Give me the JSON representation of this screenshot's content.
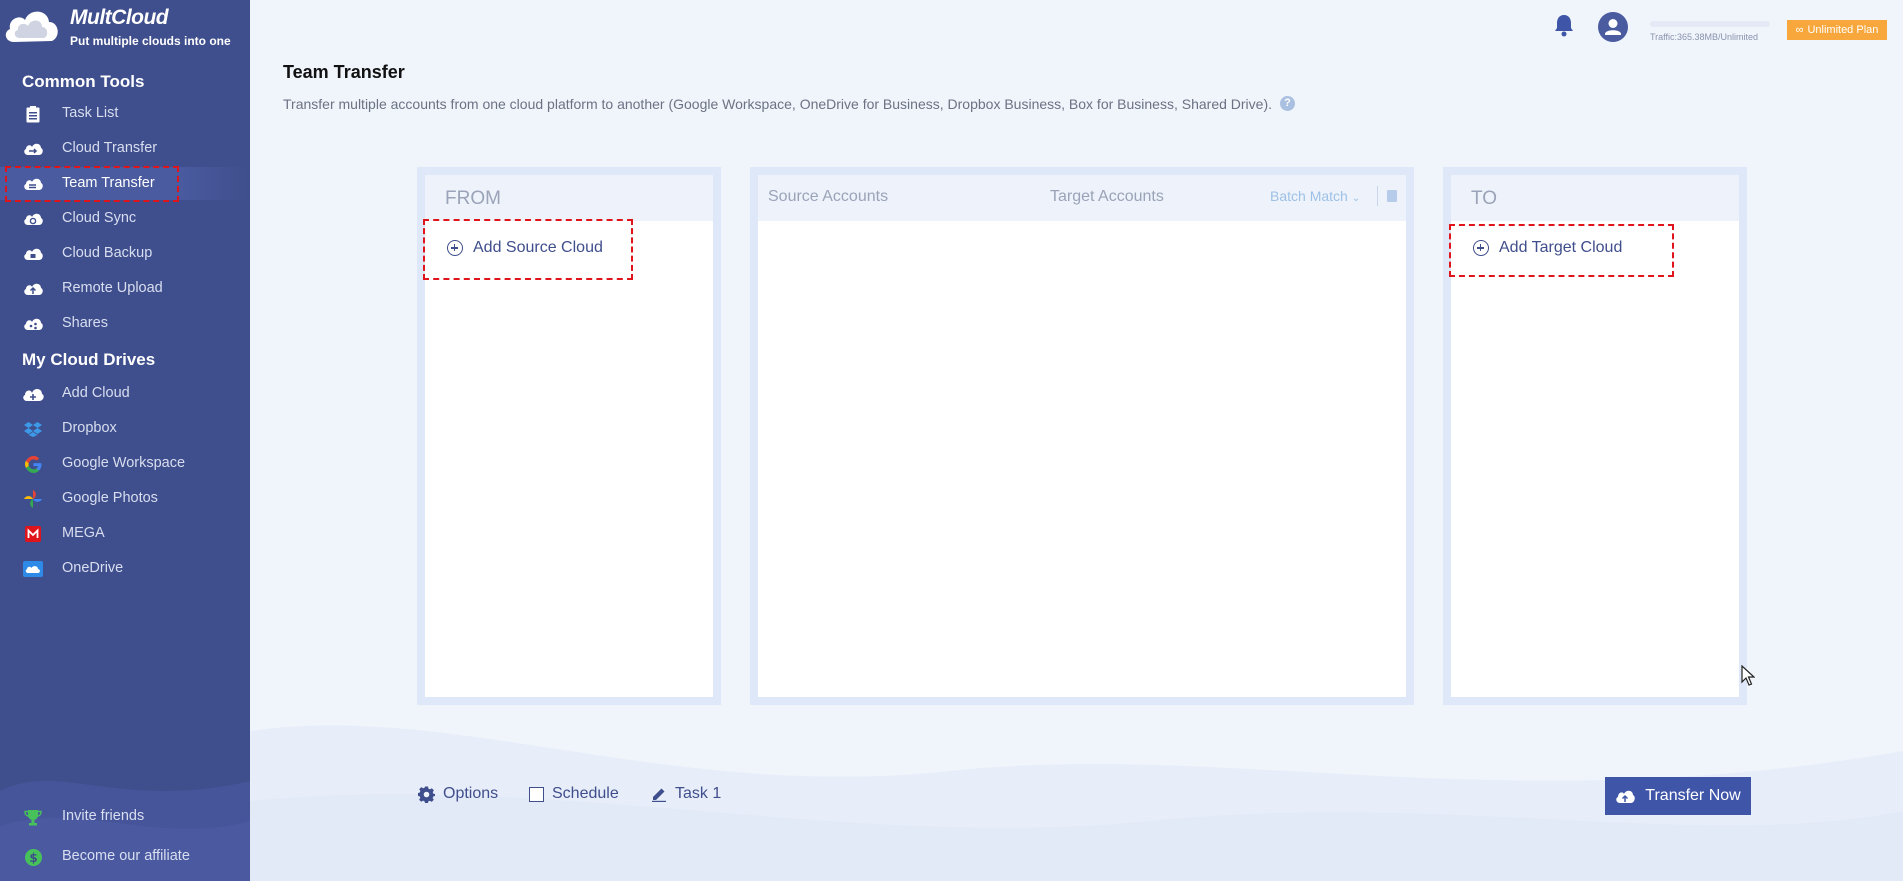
{
  "brand": {
    "name": "MultCloud",
    "tagline": "Put multiple clouds into one"
  },
  "sidebar": {
    "common_tools_title": "Common Tools",
    "common_tools": [
      {
        "label": "Task List",
        "icon": "task-list-icon"
      },
      {
        "label": "Cloud Transfer",
        "icon": "cloud-transfer-icon"
      },
      {
        "label": "Team Transfer",
        "icon": "team-transfer-icon",
        "active": true
      },
      {
        "label": "Cloud Sync",
        "icon": "cloud-sync-icon"
      },
      {
        "label": "Cloud Backup",
        "icon": "cloud-backup-icon"
      },
      {
        "label": "Remote Upload",
        "icon": "remote-upload-icon"
      },
      {
        "label": "Shares",
        "icon": "shares-icon"
      }
    ],
    "drives_title": "My Cloud Drives",
    "drives": [
      {
        "label": "Add Cloud",
        "icon": "add-cloud-icon"
      },
      {
        "label": "Dropbox",
        "icon": "dropbox-icon"
      },
      {
        "label": "Google Workspace",
        "icon": "google-icon"
      },
      {
        "label": "Google Photos",
        "icon": "google-photos-icon"
      },
      {
        "label": "MEGA",
        "icon": "mega-icon"
      },
      {
        "label": "OneDrive",
        "icon": "onedrive-icon"
      }
    ],
    "bottom": [
      {
        "label": "Invite friends",
        "icon": "trophy-icon"
      },
      {
        "label": "Become our affiliate",
        "icon": "dollar-icon"
      }
    ]
  },
  "topbar": {
    "traffic": "Traffic:365.38MB/Unlimited",
    "plan": "Unlimited Plan"
  },
  "page": {
    "title": "Team Transfer",
    "description": "Transfer multiple accounts from one cloud platform to another (Google Workspace, OneDrive for Business, Dropbox Business, Box for Business, Shared Drive).",
    "help": "?"
  },
  "from_panel": {
    "title": "FROM",
    "add_label": "Add Source Cloud"
  },
  "middle_panel": {
    "source_header": "Source Accounts",
    "target_header": "Target Accounts",
    "batch_match": "Batch Match"
  },
  "to_panel": {
    "title": "TO",
    "add_label": "Add Target Cloud"
  },
  "footer": {
    "options": "Options",
    "schedule": "Schedule",
    "task_name": "Task 1",
    "transfer_now": "Transfer Now"
  },
  "colors": {
    "sidebar": "#3f4e8c",
    "accent": "#3f55a8",
    "plan": "#f7a73c",
    "highlight": "#e0141b"
  }
}
